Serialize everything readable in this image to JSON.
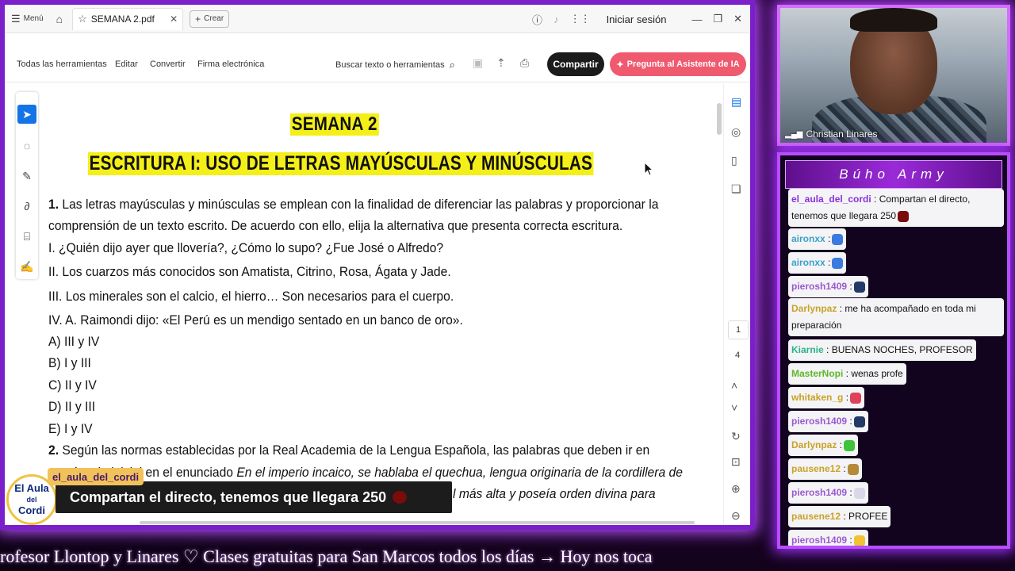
{
  "browser": {
    "menu_label": "Menú",
    "tab_title": "SEMANA 2.pdf",
    "create_label": "Crear",
    "signin_label": "Iniciar sesión"
  },
  "toolbar": {
    "all_tools": "Todas las herramientas",
    "edit": "Editar",
    "convert": "Convertir",
    "esign": "Firma electrónica",
    "search_placeholder": "Buscar texto o herramientas",
    "share": "Compartir",
    "ai_assistant": "Pregunta al Asistente de IA"
  },
  "pager": {
    "current": "1",
    "total": "4"
  },
  "document": {
    "title": "SEMANA 2",
    "subtitle": "ESCRITURA I: USO DE LETRAS MAYÚSCULAS Y MINÚSCULAS",
    "q1_num": "1.",
    "q1_line1": "Las letras mayúsculas y minúsculas se emplean con la finalidad de diferenciar las palabras y proporcionar la",
    "q1_line2": "comprensión de un texto escrito. De acuerdo con ello, elija la alternativa que presenta correcta escritura.",
    "opt_i": "I. ¿Quién dijo ayer que llovería?, ¿Cómo lo supo? ¿Fue José o Alfredo?",
    "opt_ii": "II. Los cuarzos más conocidos son Amatista, Citrino, Rosa, Ágata y Jade.",
    "opt_iii": "III. Los minerales son el calcio, el hierro… Son necesarios para el cuerpo.",
    "opt_iv": "IV. A. Raimondi dijo: «El Perú es un mendigo sentado en un banco de oro».",
    "ans_a": "A) III y IV",
    "ans_b": "B) I y III",
    "ans_c": "C) II y IV",
    "ans_d": "D) II y III",
    "ans_e": "E) I y IV",
    "q2_num": "2.",
    "q2_line1": "Según las normas establecidas por la Real Academia de la Lengua Española, las palabras que deben ir en",
    "q2_line2_a": "mayúscula inicial en el enunciado ",
    "q2_line2_b": "En el imperio incaico, se hablaba el quechua, lengua originaria de la cordillera de",
    "q2_line3": "l más alta y poseía orden divina para"
  },
  "overlay": {
    "username": "el_aula_del_cordi",
    "message": "Compartan el directo, tenemos que llegara 250",
    "logo_line1": "El Aula",
    "logo_line2": "del",
    "logo_line3": "Cordi"
  },
  "webcam": {
    "name": "Christian Linares"
  },
  "chat": {
    "title": "Búho Army",
    "messages": [
      {
        "user": "el_aula_del_cordi",
        "text": ": Compartan el directo, tenemos que llegara 250",
        "user_color": "#8b2fd9",
        "emoji_color": "#7a0c0c"
      },
      {
        "user": "aironxx",
        "text": ":",
        "user_color": "#3aa0c8",
        "emoji_color": "#3b7be0"
      },
      {
        "user": "aironxx",
        "text": ":",
        "user_color": "#3aa0c8",
        "emoji_color": "#3b7be0"
      },
      {
        "user": "pierosh1409",
        "text": ":",
        "user_color": "#9b59d0",
        "emoji_color": "#233a66"
      },
      {
        "user": "Darlynpaz",
        "text": ": me ha acompañado en toda mi preparación",
        "user_color": "#c9a227",
        "emoji_color": ""
      },
      {
        "user": "Kiarnie",
        "text": ": BUENAS NOCHES, PROFESOR",
        "user_color": "#2bb38a",
        "emoji_color": ""
      },
      {
        "user": "MasterNopi",
        "text": ": wenas profe",
        "user_color": "#5cb82a",
        "emoji_color": ""
      },
      {
        "user": "whitaken_g",
        "text": ":",
        "user_color": "#c9a227",
        "emoji_color": "#e0405a"
      },
      {
        "user": "pierosh1409",
        "text": ":",
        "user_color": "#9b59d0",
        "emoji_color": "#233a66"
      },
      {
        "user": "Darlynpaz",
        "text": ":",
        "user_color": "#c9a227",
        "emoji_color": "#3ec43a"
      },
      {
        "user": "pausene12",
        "text": ":",
        "user_color": "#c9a227",
        "emoji_color": "#b58a3a"
      },
      {
        "user": "pierosh1409",
        "text": ":",
        "user_color": "#9b59d0",
        "emoji_color": "#d8d8e8"
      },
      {
        "user": "pausene12",
        "text": ": PROFEE",
        "user_color": "#c9a227",
        "emoji_color": ""
      },
      {
        "user": "pierosh1409",
        "text": ":",
        "user_color": "#9b59d0",
        "emoji_color": "#f2c232"
      }
    ]
  },
  "ticker": {
    "text": "rofesor Llontop y Linares ♡    Clases gratuitas para San Marcos todos los días  →  Hoy nos toca"
  },
  "colors": {
    "neon": "#b84dff",
    "highlight": "#f4ef18",
    "share_btn": "#1b1b1b",
    "ai_btn": "#f05a6f",
    "select_tool": "#1473e6"
  }
}
